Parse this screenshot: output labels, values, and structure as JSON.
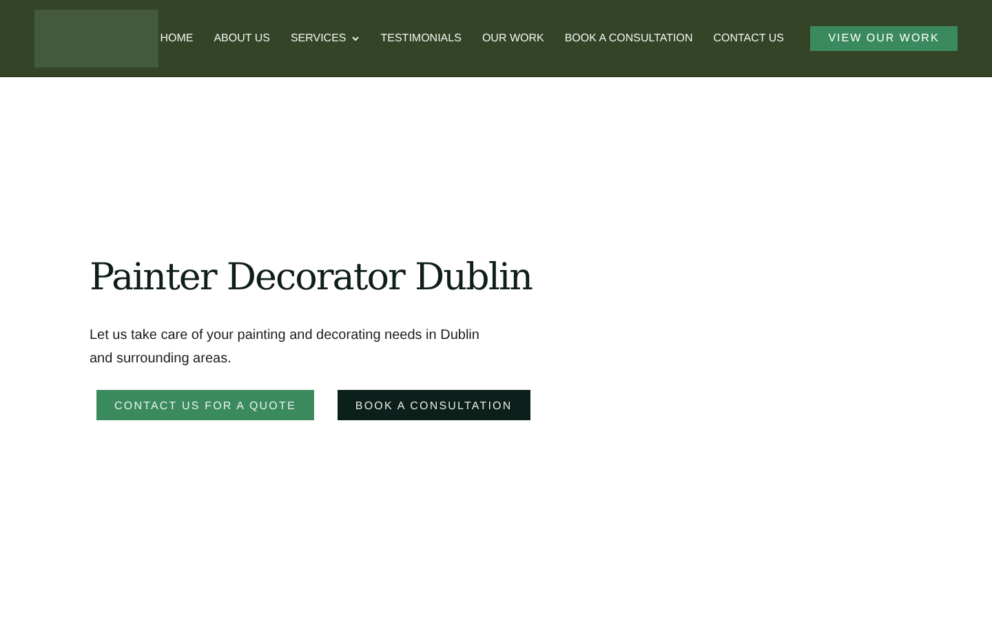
{
  "nav": {
    "items": [
      {
        "label": "HOME",
        "has_menu": false
      },
      {
        "label": "ABOUT US",
        "has_menu": false
      },
      {
        "label": "SERVICES",
        "has_menu": true
      },
      {
        "label": "TESTIMONIALS",
        "has_menu": false
      },
      {
        "label": "OUR WORK",
        "has_menu": false
      },
      {
        "label": "BOOK A CONSULTATION",
        "has_menu": false
      },
      {
        "label": "CONTACT US",
        "has_menu": false
      }
    ],
    "cta": "VIEW OUR WORK"
  },
  "hero": {
    "title": "Painter Decorator Dublin",
    "text": "Let us take care of your painting and decorating needs in Dublin and surrounding areas.",
    "buttons": [
      {
        "label": "CONTACT US FOR A QUOTE",
        "kind": "primary"
      },
      {
        "label": "BOOK A CONSULTATION",
        "kind": "dark"
      }
    ]
  }
}
